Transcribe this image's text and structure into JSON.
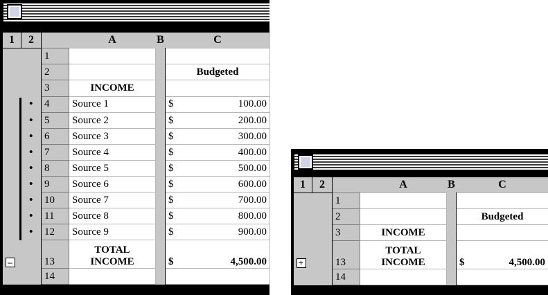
{
  "window1": {
    "level_buttons": [
      "1",
      "2"
    ],
    "columns": [
      "A",
      "B",
      "C"
    ],
    "collapse_symbol": "–",
    "detail_marker": "•",
    "rows": [
      {
        "num": "1",
        "a": "",
        "cur": "",
        "amt": "",
        "c": ""
      },
      {
        "num": "2",
        "a": "",
        "cur": "",
        "amt": "",
        "c": "Budgeted"
      },
      {
        "num": "3",
        "a": "INCOME",
        "cur": "",
        "amt": "",
        "c": ""
      },
      {
        "num": "4",
        "a": "Source 1",
        "cur": "$",
        "amt": "100.00"
      },
      {
        "num": "5",
        "a": "Source 2",
        "cur": "$",
        "amt": "200.00"
      },
      {
        "num": "6",
        "a": "Source 3",
        "cur": "$",
        "amt": "300.00"
      },
      {
        "num": "7",
        "a": "Source 4",
        "cur": "$",
        "amt": "400.00"
      },
      {
        "num": "8",
        "a": "Source 5",
        "cur": "$",
        "amt": "500.00"
      },
      {
        "num": "9",
        "a": "Source 6",
        "cur": "$",
        "amt": "600.00"
      },
      {
        "num": "10",
        "a": "Source 7",
        "cur": "$",
        "amt": "700.00"
      },
      {
        "num": "11",
        "a": "Source 8",
        "cur": "$",
        "amt": "800.00"
      },
      {
        "num": "12",
        "a": "Source 9",
        "cur": "$",
        "amt": "900.00"
      },
      {
        "num": "13",
        "a1": "TOTAL",
        "a2": "INCOME",
        "cur": "$",
        "amt": "4,500.00"
      },
      {
        "num": "14"
      }
    ]
  },
  "window2": {
    "level_buttons": [
      "1",
      "2"
    ],
    "columns": [
      "A",
      "B",
      "C"
    ],
    "expand_symbol": "+",
    "rows": [
      {
        "num": "1"
      },
      {
        "num": "2",
        "c": "Budgeted"
      },
      {
        "num": "3",
        "a": "INCOME"
      },
      {
        "num": "13",
        "a1": "TOTAL",
        "a2": "INCOME",
        "cur": "$",
        "amt": "4,500.00"
      },
      {
        "num": "14"
      }
    ]
  }
}
